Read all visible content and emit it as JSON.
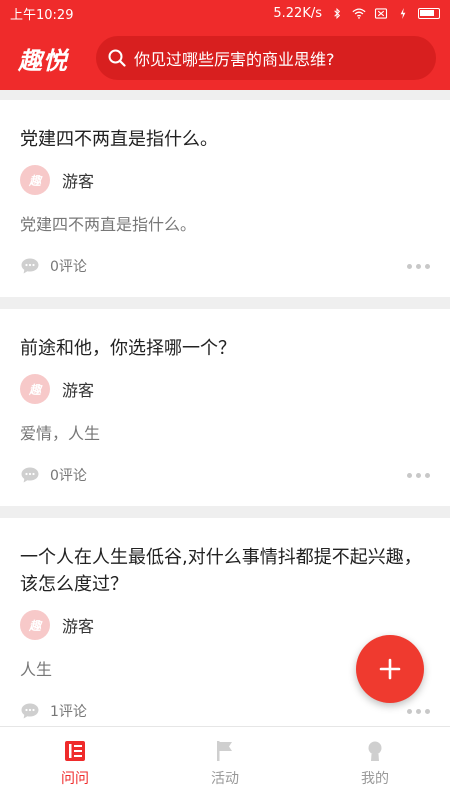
{
  "status_bar": {
    "time": "上午10:29",
    "speed": "5.22K/s"
  },
  "header": {
    "logo": "趣悦",
    "search_placeholder": "你见过哪些厉害的商业思维?"
  },
  "posts": [
    {
      "title": "党建四不两直是指什么。",
      "author": "游客",
      "avatar_text": "趣",
      "summary": "党建四不两直是指什么。",
      "comments": "0评论"
    },
    {
      "title": "前途和他，你选择哪一个？",
      "author": "游客",
      "avatar_text": "趣",
      "summary": "爱情，人生",
      "comments": "0评论"
    },
    {
      "title": "一个人在人生最低谷,对什么事情抖都提不起兴趣，该怎么度过？",
      "author": "游客",
      "avatar_text": "趣",
      "summary": "人生",
      "comments": "1评论"
    }
  ],
  "nav": [
    {
      "label": "问问",
      "icon": "book-icon",
      "active": true
    },
    {
      "label": "活动",
      "icon": "flag-icon",
      "active": false
    },
    {
      "label": "我的",
      "icon": "user-icon",
      "active": false
    }
  ],
  "colors": {
    "brand": "#ef2b2b",
    "fab": "#ef3a2f",
    "muted": "#999999"
  }
}
